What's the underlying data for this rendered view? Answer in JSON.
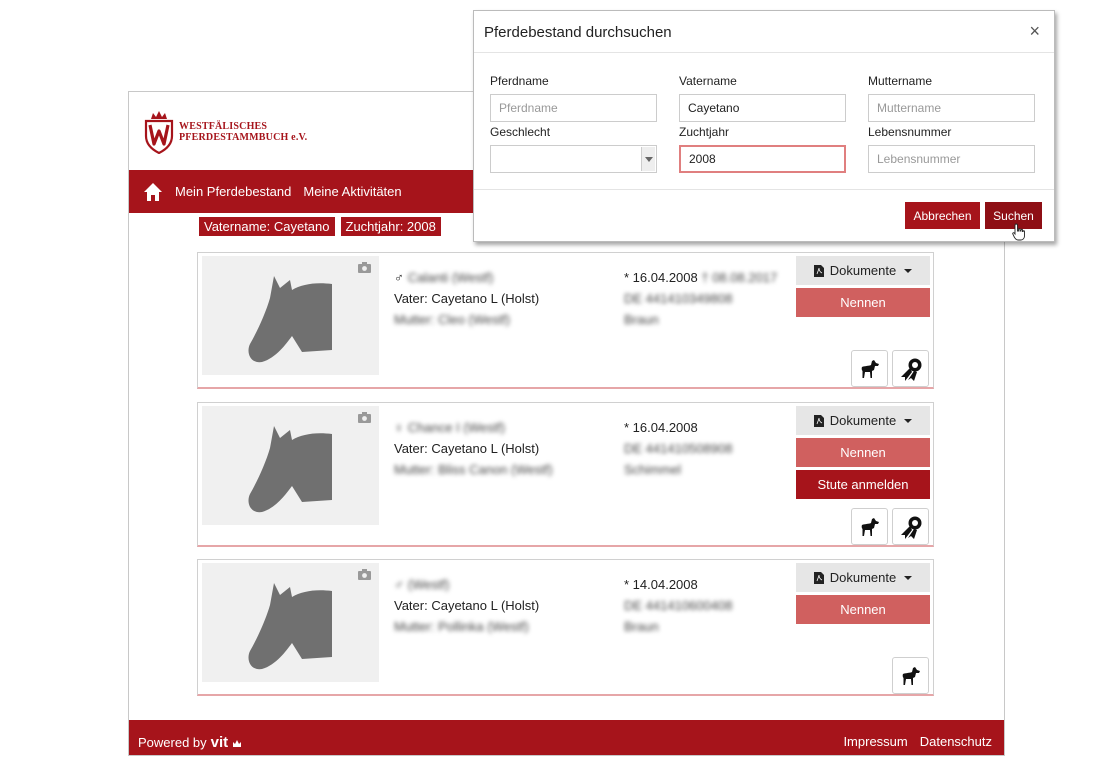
{
  "brand": {
    "line1": "WESTFÄLISCHES",
    "line2": "PFERDESTAMMBUCH e.V.",
    "color": "#a6141b"
  },
  "nav": {
    "home_icon": "home-icon",
    "items": [
      "Mein Pferdebestand",
      "Meine Aktivitäten"
    ]
  },
  "filters": [
    "Vatername: Cayetano",
    "Zuchtjahr: 2008"
  ],
  "cards": [
    {
      "sex": "♂",
      "name": "Calanti (Westf)",
      "father": "Vater: Cayetano L (Holst)",
      "mother": "Mutter: Cleo (Westf)",
      "born": "* 16.04.2008",
      "died": "† 08.08.2017",
      "ueln": "DE 441410349808",
      "color": "Braun",
      "documents_label": "Dokumente",
      "buttons": [
        "Nennen"
      ]
    },
    {
      "sex": "♀",
      "name": "Chance I (Westf)",
      "father": "Vater: Cayetano L (Holst)",
      "mother": "Mutter: Bliss Canon (Westf)",
      "born": "* 16.04.2008",
      "ueln": "DE 441410508908",
      "color": "Schimmel",
      "documents_label": "Dokumente",
      "buttons": [
        "Nennen",
        "Stute anmelden"
      ]
    },
    {
      "sex": "♂",
      "name": "(Westf)",
      "father": "Vater: Cayetano L (Holst)",
      "mother": "Mutter: Pollinka (Westf)",
      "born": "* 14.04.2008",
      "ueln": "DE 441410600408",
      "color": "Braun",
      "documents_label": "Dokumente",
      "buttons": [
        "Nennen"
      ]
    }
  ],
  "footer": {
    "powered_label": "Powered by",
    "powered_brand": "vit",
    "links": [
      "Impressum",
      "Datenschutz"
    ]
  },
  "modal": {
    "title": "Pferdebestand durchsuchen",
    "close_glyph": "×",
    "fields": {
      "pferdname": {
        "label": "Pferdname",
        "placeholder": "Pferdname",
        "value": ""
      },
      "vatername": {
        "label": "Vatername",
        "placeholder": "Vatername",
        "value": "Cayetano"
      },
      "muttername": {
        "label": "Muttername",
        "placeholder": "Muttername",
        "value": ""
      },
      "geschlecht": {
        "label": "Geschlecht",
        "value": ""
      },
      "zuchtjahr": {
        "label": "Zuchtjahr",
        "placeholder": "Zuchtjahr",
        "value": "2008"
      },
      "lebensnummer": {
        "label": "Lebensnummer",
        "placeholder": "Lebensnummer",
        "value": ""
      }
    },
    "cancel_label": "Abbrechen",
    "search_label": "Suchen"
  }
}
